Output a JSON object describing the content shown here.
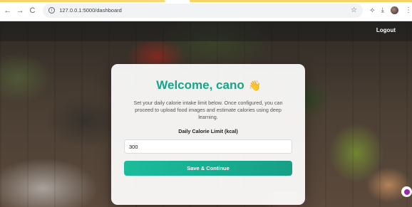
{
  "browser": {
    "url": "127.0.0.1:5000/dashboard",
    "back": "←",
    "forward": "→",
    "reload": "C",
    "info": "i",
    "star": "☆",
    "extensions": "⟡",
    "download": "⤓",
    "menu": "⋮"
  },
  "nav": {
    "logout_label": "Logout"
  },
  "card": {
    "title": "Welcome, cano",
    "wave": "👋",
    "description": "Set your daily calorie intake limit below. Once configured, you can proceed to upload food images and estimate calories using deep learning.",
    "field_label": "Daily Calorie Limit (kcal)",
    "field_value": "300",
    "submit_label": "Save & Continue"
  },
  "colors": {
    "accent": "#17a589",
    "button": "#1abc9c"
  }
}
